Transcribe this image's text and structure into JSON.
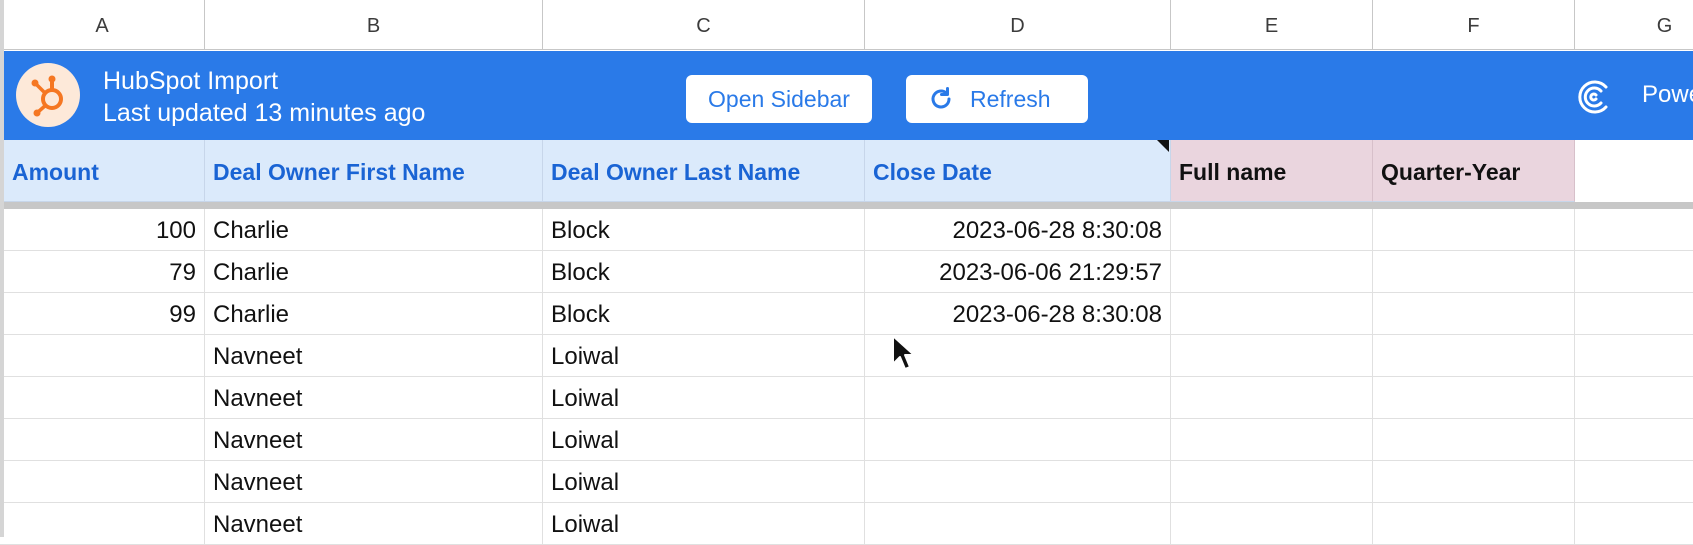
{
  "columns": [
    "A",
    "B",
    "C",
    "D",
    "E",
    "F",
    "G"
  ],
  "banner": {
    "title": "HubSpot Import",
    "subtitle": "Last updated 13 minutes ago",
    "open_sidebar_label": "Open Sidebar",
    "refresh_label": "Refresh",
    "brand_text": "Powe",
    "logo_icon": "hubspot-sprocket-icon",
    "brand_icon": "coefficient-logo-icon",
    "bg_color": "#2a7ae8",
    "logo_color": "#f57722"
  },
  "fields": [
    {
      "label": "Amount",
      "style": "blue"
    },
    {
      "label": "Deal Owner First Name",
      "style": "blue"
    },
    {
      "label": "Deal Owner Last Name",
      "style": "blue"
    },
    {
      "label": "Close Date",
      "style": "blue"
    },
    {
      "label": "Full name",
      "style": "pink"
    },
    {
      "label": "Quarter-Year",
      "style": "pink"
    }
  ],
  "rows": [
    {
      "amount": "100",
      "first": "Charlie",
      "last": "Block",
      "close": "2023-06-28 8:30:08",
      "full": "",
      "quarter": ""
    },
    {
      "amount": "79",
      "first": "Charlie",
      "last": "Block",
      "close": "2023-06-06 21:29:57",
      "full": "",
      "quarter": ""
    },
    {
      "amount": "99",
      "first": "Charlie",
      "last": "Block",
      "close": "2023-06-28 8:30:08",
      "full": "",
      "quarter": ""
    },
    {
      "amount": "",
      "first": "Navneet",
      "last": "Loiwal",
      "close": "",
      "full": "",
      "quarter": ""
    },
    {
      "amount": "",
      "first": "Navneet",
      "last": "Loiwal",
      "close": "",
      "full": "",
      "quarter": ""
    },
    {
      "amount": "",
      "first": "Navneet",
      "last": "Loiwal",
      "close": "",
      "full": "",
      "quarter": ""
    },
    {
      "amount": "",
      "first": "Navneet",
      "last": "Loiwal",
      "close": "",
      "full": "",
      "quarter": ""
    },
    {
      "amount": "",
      "first": "Navneet",
      "last": "Loiwal",
      "close": "",
      "full": "",
      "quarter": ""
    }
  ]
}
